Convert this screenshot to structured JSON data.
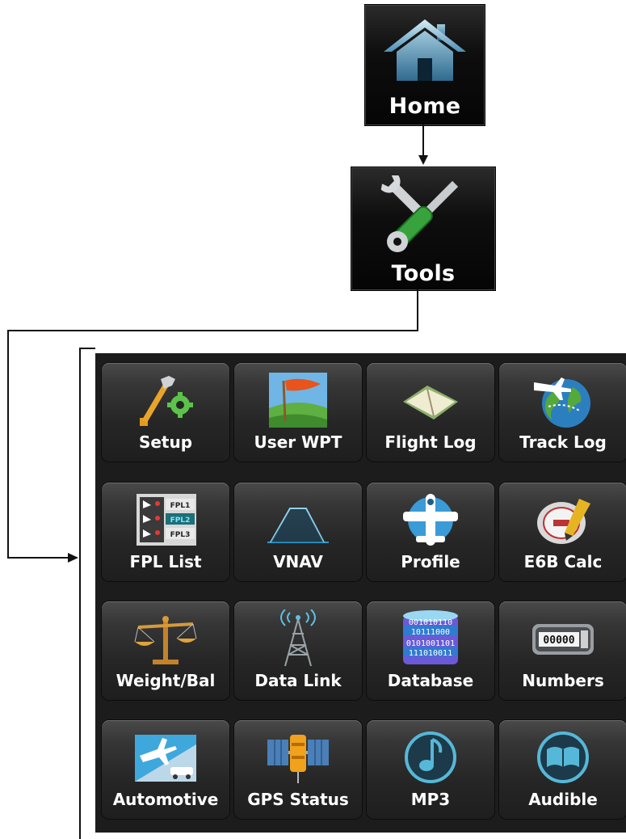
{
  "home": {
    "label": "Home"
  },
  "tools": {
    "label": "Tools"
  },
  "tiles": [
    {
      "label": "Setup",
      "icon": "wrench-gear-icon"
    },
    {
      "label": "User WPT",
      "icon": "flag-icon"
    },
    {
      "label": "Flight Log",
      "icon": "open-logbook-icon"
    },
    {
      "label": "Track Log",
      "icon": "globe-airplane-icon"
    },
    {
      "label": "FPL List",
      "icon": "flight-plan-list-icon"
    },
    {
      "label": "VNAV",
      "icon": "vertical-profile-icon"
    },
    {
      "label": "Profile",
      "icon": "airplane-profile-icon"
    },
    {
      "label": "E6B Calc",
      "icon": "e6b-computer-icon"
    },
    {
      "label": "Weight/Bal",
      "icon": "balance-scale-icon"
    },
    {
      "label": "Data Link",
      "icon": "radio-tower-icon"
    },
    {
      "label": "Database",
      "icon": "database-icon"
    },
    {
      "label": "Numbers",
      "icon": "counter-icon"
    },
    {
      "label": "Automotive",
      "icon": "airplane-car-icon"
    },
    {
      "label": "GPS Status",
      "icon": "gps-satellite-icon"
    },
    {
      "label": "MP3",
      "icon": "music-note-icon"
    },
    {
      "label": "Audible",
      "icon": "audiobook-icon"
    }
  ],
  "fpl_icon_text": [
    "FPL1",
    "FPL2",
    "FPL3"
  ],
  "database_icon_text": [
    "001010110",
    "10111000",
    "0101001101",
    "111010011"
  ],
  "numbers_icon_text": "00000",
  "colors": {
    "accent_green": "#3aa63a",
    "highlight_cyan": "#2aa9c9",
    "background": "#1c1c1c"
  }
}
